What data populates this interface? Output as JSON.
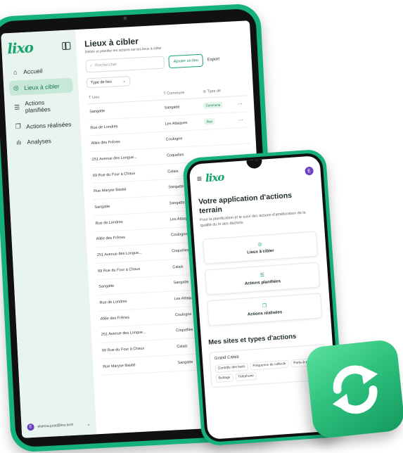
{
  "tablet": {
    "brand": "lixo",
    "nav": [
      {
        "icon": "home-icon",
        "glyph": "⌂",
        "label": "Accueil"
      },
      {
        "icon": "target-icon",
        "glyph": "◎",
        "label": "Lieux à cibler"
      },
      {
        "icon": "list-icon",
        "glyph": "☰",
        "label": "Actions planifiées"
      },
      {
        "icon": "copy-icon",
        "glyph": "❐",
        "label": "Actions réalisées"
      },
      {
        "icon": "chart-icon",
        "glyph": "ılı",
        "label": "Analyses"
      }
    ],
    "user": {
      "initial": "E",
      "email": "elianna.jurat@lixo.tech"
    },
    "page": {
      "title": "Lieux à cibler",
      "subtitle": "Définir et planifier les actions sur les lieux à cibler",
      "search_placeholder": "Rechercher",
      "add_button": "Ajouter un lieu",
      "export_button": "Export",
      "filter_label": "Type de lieu"
    },
    "table": {
      "headers": [
        "Lieu",
        "Commune",
        "Type de"
      ],
      "rows": [
        [
          "Sangatte",
          "Sangatte",
          "Commune"
        ],
        [
          "Rue de Londres",
          "Les Attaques",
          "Rue"
        ],
        [
          "Allée des Frênes",
          "Coulogne",
          ""
        ],
        [
          "251 Avenue des Longue...",
          "Coquelles",
          ""
        ],
        [
          "69 Rue du Four à Chaux",
          "Calais",
          ""
        ],
        [
          "Rue Maryse Bastié",
          "Sangatte",
          ""
        ],
        [
          "Sangatte",
          "Sangatte",
          ""
        ],
        [
          "Rue de Londres",
          "Les Attaques",
          ""
        ],
        [
          "Allée des Frênes",
          "Coulogne",
          ""
        ],
        [
          "251 Avenue des Longue...",
          "Coquelles",
          ""
        ],
        [
          "69 Rue du Four à Chaux",
          "Calais",
          ""
        ],
        [
          "Sangatte",
          "Sangatte",
          ""
        ],
        [
          "Rue de Londres",
          "Les Attaques",
          ""
        ],
        [
          "Allée des Frênes",
          "Coulogne",
          ""
        ],
        [
          "251 Avenue des Longue...",
          "Coquelles",
          ""
        ],
        [
          "69 Rue du Four à Chaux",
          "Calais",
          ""
        ],
        [
          "Rue Maryse Bastié",
          "Sangatte",
          ""
        ]
      ]
    }
  },
  "phone": {
    "brand": "lixo",
    "avatar_initial": "E",
    "title": "Votre application d'actions terrain",
    "description": "Pour la planification et le suivi des actions d'amélioration de la qualité du tri des déchets",
    "cards": [
      {
        "icon": "target-icon",
        "glyph": "◎",
        "label": "Lieux à cibler"
      },
      {
        "icon": "list-icon",
        "glyph": "☰",
        "label": "Actions planifiées"
      },
      {
        "icon": "copy-icon",
        "glyph": "❐",
        "label": "Actions réalisées"
      }
    ],
    "section_title": "Mes sites et types d'actions",
    "site": {
      "name": "Grand Calais",
      "chips": [
        "Contrôle des bacs",
        "Fréquence de collecte",
        "Porte-à-porte",
        "Boîtage",
        "Téléphone"
      ]
    }
  },
  "colors": {
    "brand_green": "#19a46d",
    "frame_green": "#14b27a",
    "avatar_purple": "#6a3fc2"
  }
}
